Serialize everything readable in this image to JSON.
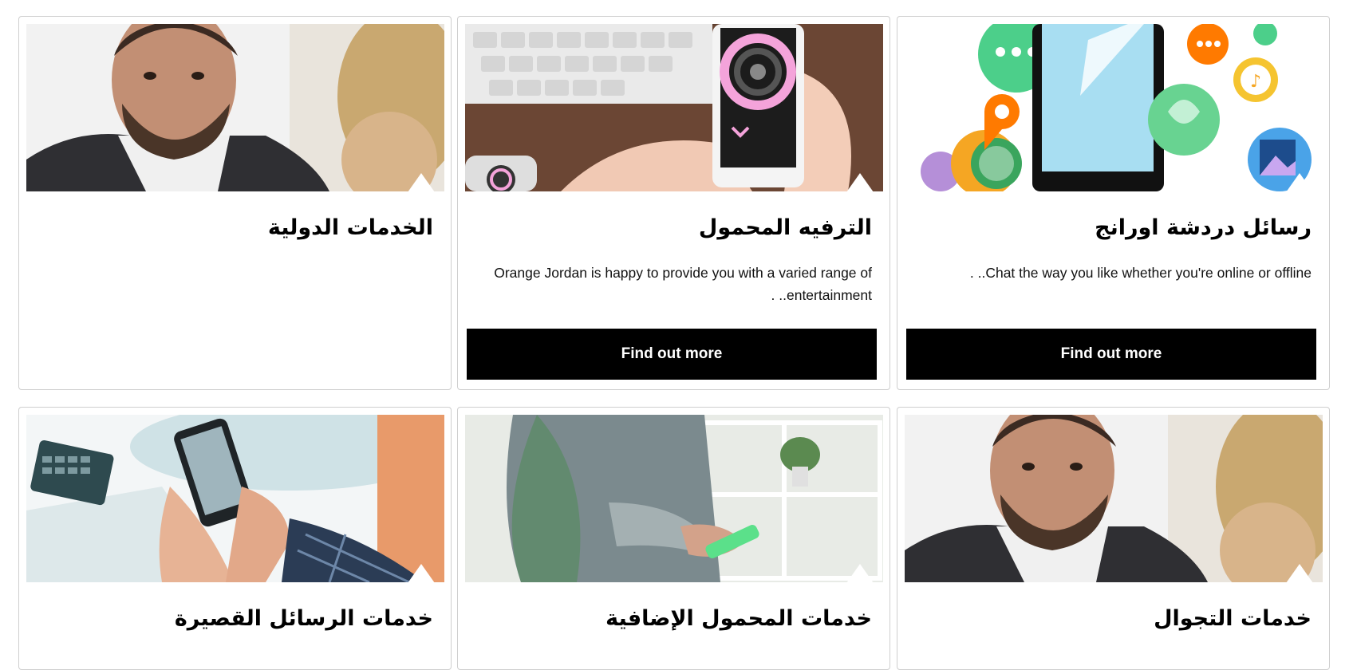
{
  "cards": [
    {
      "title": "رسائل دردشة اورانج",
      "description": "Chat the way you like whether you're online or offline.. .",
      "button": "Find out more",
      "image_icon": "chat-apps-icon"
    },
    {
      "title": "الترفيه المحمول",
      "description": "Orange Jordan is happy to provide you with a varied range of entertainment.. .",
      "button": "Find out more",
      "image_icon": "phone-smartwatch-photo"
    },
    {
      "title": "الخدمات الدولية",
      "image_icon": "businessman-photo"
    },
    {
      "title": "خدمات التجوال",
      "image_icon": "businessman-photo"
    },
    {
      "title": "خدمات المحمول الإضافية",
      "image_icon": "man-with-phone-photo"
    },
    {
      "title": "خدمات الرسائل القصيرة",
      "image_icon": "hands-typing-phone-photo"
    }
  ],
  "colors": {
    "button_bg": "#000000",
    "button_text": "#ffffff",
    "card_border": "#cfcfcf"
  }
}
